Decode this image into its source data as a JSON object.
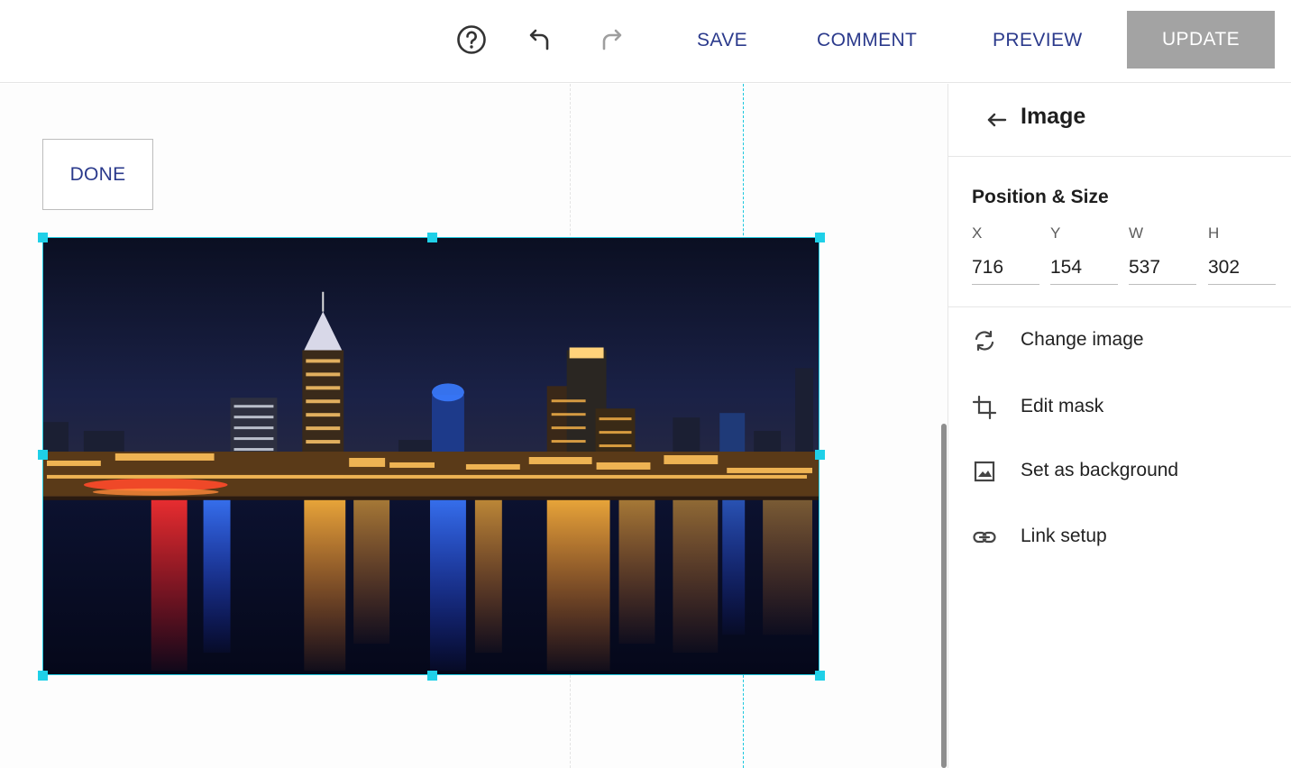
{
  "toolbar": {
    "help_icon": "help-circle-icon",
    "undo_icon": "undo-icon",
    "redo_icon": "redo-icon",
    "save_label": "SAVE",
    "comment_label": "COMMENT",
    "preview_label": "PREVIEW",
    "update_label": "UPDATE"
  },
  "canvas": {
    "done_label": "DONE",
    "image_description": "city skyline at night"
  },
  "panel": {
    "title": "Image",
    "position_size": {
      "title": "Position & Size",
      "fields": [
        {
          "label": "X",
          "value": "716"
        },
        {
          "label": "Y",
          "value": "154"
        },
        {
          "label": "W",
          "value": "537"
        },
        {
          "label": "H",
          "value": "302"
        }
      ]
    },
    "menu": [
      {
        "label": "Change image",
        "icon": "refresh-icon"
      },
      {
        "label": "Edit mask",
        "icon": "crop-icon"
      },
      {
        "label": "Set as background",
        "icon": "image-icon"
      },
      {
        "label": "Link setup",
        "icon": "link-icon"
      }
    ]
  },
  "colors": {
    "accent_text": "#2b3a8c",
    "selection": "#1fd0e8",
    "update_bg": "#a3a3a3"
  }
}
